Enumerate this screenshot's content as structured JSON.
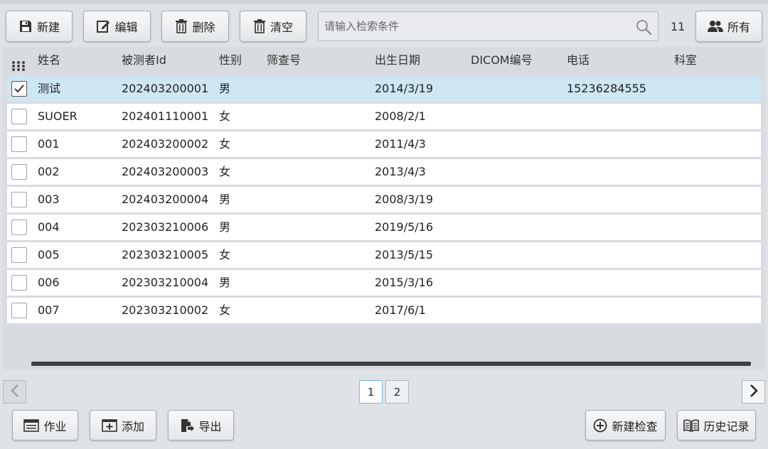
{
  "toolbar": {
    "new_label": "新建",
    "edit_label": "编辑",
    "delete_label": "删除",
    "clear_label": "清空",
    "all_label": "所有"
  },
  "search": {
    "placeholder": "请输入检索条件",
    "value": ""
  },
  "record_count": "11",
  "table": {
    "headers": [
      "姓名",
      "被测者Id",
      "性别",
      "筛查号",
      "出生日期",
      "DICOM编号",
      "电话",
      "科室"
    ],
    "rows": [
      {
        "selected": true,
        "name": "测试",
        "id": "202403200001",
        "gender": "男",
        "screening": "",
        "birth": "2014/3/19",
        "dicom": "",
        "phone": "15236284555",
        "dept": ""
      },
      {
        "selected": false,
        "name": "SUOER",
        "id": "202401110001",
        "gender": "女",
        "screening": "",
        "birth": "2008/2/1",
        "dicom": "",
        "phone": "",
        "dept": ""
      },
      {
        "selected": false,
        "name": "001",
        "id": "202403200002",
        "gender": "女",
        "screening": "",
        "birth": "2011/4/3",
        "dicom": "",
        "phone": "",
        "dept": ""
      },
      {
        "selected": false,
        "name": "002",
        "id": "202403200003",
        "gender": "女",
        "screening": "",
        "birth": "2013/4/3",
        "dicom": "",
        "phone": "",
        "dept": ""
      },
      {
        "selected": false,
        "name": "003",
        "id": "202403200004",
        "gender": "男",
        "screening": "",
        "birth": "2008/3/19",
        "dicom": "",
        "phone": "",
        "dept": ""
      },
      {
        "selected": false,
        "name": "004",
        "id": "202303210006",
        "gender": "男",
        "screening": "",
        "birth": "2019/5/16",
        "dicom": "",
        "phone": "",
        "dept": ""
      },
      {
        "selected": false,
        "name": "005",
        "id": "202303210005",
        "gender": "女",
        "screening": "",
        "birth": "2013/5/15",
        "dicom": "",
        "phone": "",
        "dept": ""
      },
      {
        "selected": false,
        "name": "006",
        "id": "202303210004",
        "gender": "男",
        "screening": "",
        "birth": "2015/3/16",
        "dicom": "",
        "phone": "",
        "dept": ""
      },
      {
        "selected": false,
        "name": "007",
        "id": "202303210002",
        "gender": "女",
        "screening": "",
        "birth": "2017/6/1",
        "dicom": "",
        "phone": "",
        "dept": ""
      }
    ]
  },
  "pagination": {
    "pages": [
      "1",
      "2"
    ],
    "current": "1"
  },
  "footer": {
    "job_label": "作业",
    "add_label": "添加",
    "export_label": "导出",
    "new_exam_label": "新建检查",
    "history_label": "历史记录"
  },
  "colors": {
    "selected_row": "#cfe6f3",
    "background": "#dfe2e6",
    "active_page_border": "#7fb7d8"
  }
}
